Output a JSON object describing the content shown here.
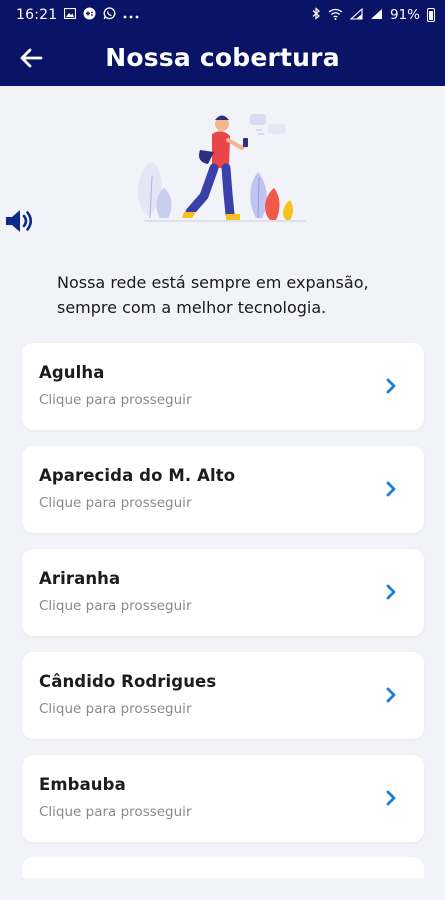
{
  "status_bar": {
    "time": "16:21",
    "battery": "91%",
    "left_icons": [
      "gallery-icon",
      "game-icon",
      "whatsapp-icon",
      "more-icon"
    ],
    "right_icons": [
      "bluetooth-icon",
      "wifi-icon",
      "signal-icon",
      "signal-icon",
      "battery-icon"
    ]
  },
  "header": {
    "title": "Nossa cobertura",
    "back_icon": "back-arrow-icon"
  },
  "intro": {
    "text_line1": "Nossa rede está sempre em expansão,",
    "text_line2": "sempre com a melhor tecnologia."
  },
  "cities": [
    {
      "name": "Agulha",
      "subtitle": "Clique para prosseguir"
    },
    {
      "name": "Aparecida do M. Alto",
      "subtitle": "Clique para prosseguir"
    },
    {
      "name": "Ariranha",
      "subtitle": "Clique para prosseguir"
    },
    {
      "name": "Cândido Rodrigues",
      "subtitle": "Clique para prosseguir"
    },
    {
      "name": "Embauba",
      "subtitle": "Clique para prosseguir"
    }
  ],
  "colors": {
    "header_bg": "#0a1466",
    "page_bg": "#f2f3f8",
    "card_bg": "#ffffff",
    "chevron": "#1a7fd6",
    "sound_icon": "#0d2a8a"
  }
}
